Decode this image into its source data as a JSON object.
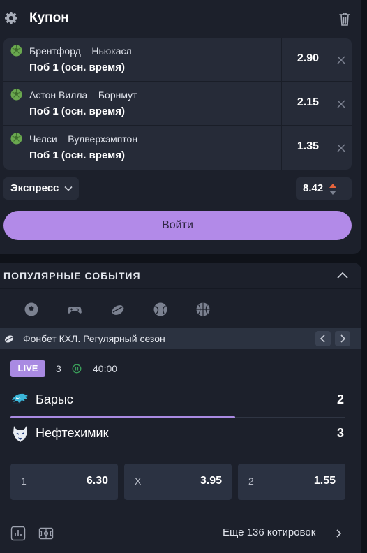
{
  "coupon": {
    "title": "Купон",
    "bets": [
      {
        "match": "Брентфорд – Ньюкасл",
        "outcome": "Поб 1 (осн. время)",
        "odds": "2.90"
      },
      {
        "match": "Астон Вилла – Борнмут",
        "outcome": "Поб 1 (осн. время)",
        "odds": "2.15"
      },
      {
        "match": "Челси – Вулверхэмптон",
        "outcome": "Поб 1 (осн. время)",
        "odds": "1.35"
      }
    ],
    "bet_type": "Экспресс",
    "total_odds": "8.42",
    "login_label": "Войти",
    "colors": {
      "accent": "#b28ae8",
      "ball": "#6aa84f"
    }
  },
  "popular": {
    "title": "ПОПУЛЯРНЫЕ СОБЫТИЯ",
    "sport_tabs": [
      "football-icon",
      "esports-gamepad-icon",
      "hockey-puck-icon",
      "tennis-icon",
      "basketball-icon"
    ],
    "league": "Фонбет КХЛ. Регулярный сезон",
    "event": {
      "live_label": "LIVE",
      "period": "3",
      "time": "40:00",
      "progress": 0.67,
      "home": {
        "name": "Барыс",
        "score": "2"
      },
      "away": {
        "name": "Нефтехимик",
        "score": "3"
      }
    },
    "odds": [
      {
        "label": "1",
        "value": "6.30"
      },
      {
        "label": "X",
        "value": "3.95"
      },
      {
        "label": "2",
        "value": "1.55"
      }
    ],
    "more_link": "Еще 136 котировок"
  }
}
